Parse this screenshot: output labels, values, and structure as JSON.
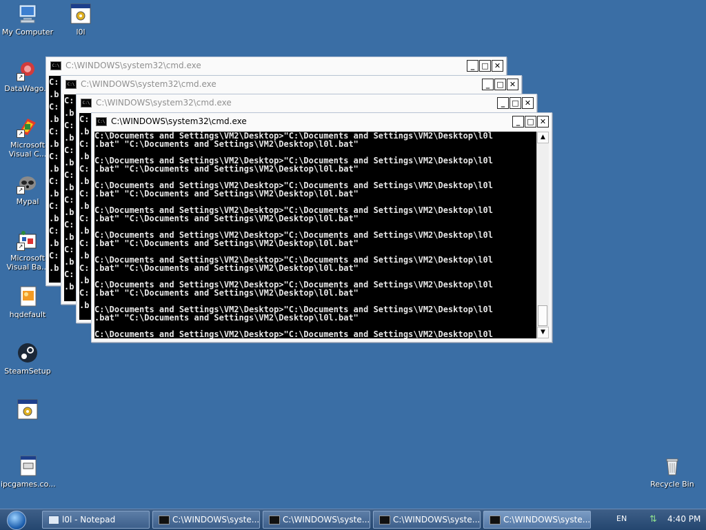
{
  "desktop": {
    "icons": [
      {
        "label": "My Computer"
      },
      {
        "label": "l0l"
      },
      {
        "label": "DataWago..."
      },
      {
        "label": "Microsoft Visual C..."
      },
      {
        "label": "Mypal"
      },
      {
        "label": "Microsoft Visual Ba..."
      },
      {
        "label": "hqdefault"
      },
      {
        "label": "SteamSetup"
      },
      {
        "label": ""
      },
      {
        "label": "ipcgames.co..."
      },
      {
        "label": "Recycle Bin"
      }
    ]
  },
  "windows": [
    {
      "title": "C:\\WINDOWS\\system32\\cmd.exe",
      "lines": [
        "C:",
        ".b",
        "C:",
        ".b",
        "C:",
        ".b",
        "C:",
        ".b",
        "C:",
        ".b",
        "C:",
        ".b",
        "C:",
        ".b",
        "C:",
        ".b"
      ]
    },
    {
      "title": "C:\\WINDOWS\\system32\\cmd.exe",
      "lines": [
        "C:",
        ".b",
        "C:",
        ".b",
        "C:",
        ".b",
        "C:",
        ".b",
        "C:",
        ".b",
        "C:",
        ".b",
        "C:",
        ".b",
        "C:",
        ".b"
      ]
    },
    {
      "title": "C:\\WINDOWS\\system32\\cmd.exe",
      "lines": [
        "C:",
        ".b",
        "C:",
        ".b",
        "C:",
        ".b",
        "C:",
        ".b",
        "C:",
        ".b",
        "C:",
        ".b",
        "C:",
        ".b",
        "C:",
        ".b"
      ]
    },
    {
      "title": "C:\\WINDOWS\\system32\\cmd.exe",
      "text": "C:\\Documents and Settings\\VM2\\Desktop>\"C:\\Documents and Settings\\VM2\\Desktop\\l0l\n.bat\" \"C:\\Documents and Settings\\VM2\\Desktop\\l0l.bat\"\n\nC:\\Documents and Settings\\VM2\\Desktop>\"C:\\Documents and Settings\\VM2\\Desktop\\l0l\n.bat\" \"C:\\Documents and Settings\\VM2\\Desktop\\l0l.bat\"\n\nC:\\Documents and Settings\\VM2\\Desktop>\"C:\\Documents and Settings\\VM2\\Desktop\\l0l\n.bat\" \"C:\\Documents and Settings\\VM2\\Desktop\\l0l.bat\"\n\nC:\\Documents and Settings\\VM2\\Desktop>\"C:\\Documents and Settings\\VM2\\Desktop\\l0l\n.bat\" \"C:\\Documents and Settings\\VM2\\Desktop\\l0l.bat\"\n\nC:\\Documents and Settings\\VM2\\Desktop>\"C:\\Documents and Settings\\VM2\\Desktop\\l0l\n.bat\" \"C:\\Documents and Settings\\VM2\\Desktop\\l0l.bat\"\n\nC:\\Documents and Settings\\VM2\\Desktop>\"C:\\Documents and Settings\\VM2\\Desktop\\l0l\n.bat\" \"C:\\Documents and Settings\\VM2\\Desktop\\l0l.bat\"\n\nC:\\Documents and Settings\\VM2\\Desktop>\"C:\\Documents and Settings\\VM2\\Desktop\\l0l\n.bat\" \"C:\\Documents and Settings\\VM2\\Desktop\\l0l.bat\"\n\nC:\\Documents and Settings\\VM2\\Desktop>\"C:\\Documents and Settings\\VM2\\Desktop\\l0l\n.bat\" \"C:\\Documents and Settings\\VM2\\Desktop\\l0l.bat\"\n\nC:\\Documents and Settings\\VM2\\Desktop>\"C:\\Documents and Settings\\VM2\\Desktop\\l0l"
    }
  ],
  "window_buttons": {
    "minimize": "_",
    "maximize": "□",
    "close": "✕"
  },
  "taskbar": {
    "buttons": [
      {
        "label": "l0l - Notepad",
        "icon": "notepad-icon"
      },
      {
        "label": "C:\\WINDOWS\\syste...",
        "icon": "cmd-icon"
      },
      {
        "label": "C:\\WINDOWS\\syste...",
        "icon": "cmd-icon"
      },
      {
        "label": "C:\\WINDOWS\\syste...",
        "icon": "cmd-icon"
      },
      {
        "label": "C:\\WINDOWS\\syste...",
        "icon": "cmd-icon"
      }
    ],
    "language": "EN",
    "clock": "4:40 PM"
  },
  "colors": {
    "desktop": "#3a6ea5",
    "console_bg": "#000000",
    "console_fg": "#e8e8e8"
  }
}
